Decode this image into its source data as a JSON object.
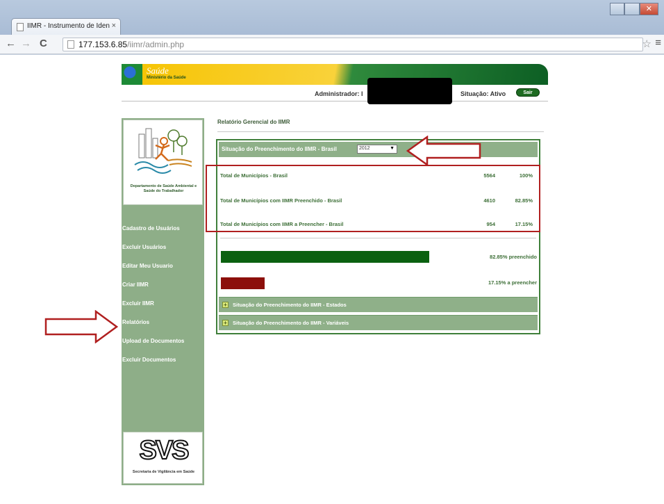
{
  "browser": {
    "tab_title": "IIMR - Instrumento de Iden",
    "tab_close": "×",
    "url_host": "177.153.6.85",
    "url_path": "/iimr/admin.php",
    "back": "←",
    "forward": "→",
    "reload": "C",
    "star": "☆",
    "menu": "≡"
  },
  "header": {
    "brand_name": "Saúde",
    "brand_sub": "Ministério da Saúde",
    "admin_label": "Administrador: I",
    "status_label": "Situação: Ativo",
    "exit_label": "Sair"
  },
  "sidebar": {
    "department": "Departamento de Saúde Ambiental e Saúde do Trabalhador",
    "items": [
      {
        "label": "Cadastro de Usuários"
      },
      {
        "label": "Excluir Usuários"
      },
      {
        "label": "Editar Meu Usuario"
      },
      {
        "label": "Criar IIMR"
      },
      {
        "label": "Excluir IIMR"
      },
      {
        "label": "Relatórios"
      },
      {
        "label": "Upload de Documentos"
      },
      {
        "label": "Excluir Documentos"
      }
    ],
    "svs_logo": "SVS",
    "svs_caption": "Secretaria de Vigilância em Saúde"
  },
  "main": {
    "report_title": "Relatório Gerencial do IIMR",
    "panel_header": "Situação do Preenchimento do IIMR - Brasil",
    "year_selected": "2012",
    "year_caret": "▼",
    "stats": [
      {
        "label": "Total de Municípios - Brasil",
        "count": "5564",
        "pct": "100%"
      },
      {
        "label": "Total de Municípios com IIMR Preenchido - Brasil",
        "count": "4610",
        "pct": "82.85%"
      },
      {
        "label": "Total de Municípios com IIMR a Preencher - Brasil",
        "count": "954",
        "pct": "17.15%"
      }
    ],
    "bar_filled": {
      "fraction": 1.0,
      "label": "82.85% preenchido",
      "color": "#0b6110"
    },
    "bar_pending": {
      "fraction": 0.21,
      "label": "17.15% a preencher",
      "color": "#8c0f0b"
    },
    "collapsed_sections": [
      {
        "label": "Situação do Preenchimento do IIMR - Estados",
        "icon": "+"
      },
      {
        "label": "Situação do Preenchimento do IIMR - Variáveis",
        "icon": "+"
      }
    ]
  },
  "colors": {
    "sidebar_bg": "#8eae88",
    "panel_border": "#3f7f3a",
    "annotation_red": "#b01f1f"
  }
}
